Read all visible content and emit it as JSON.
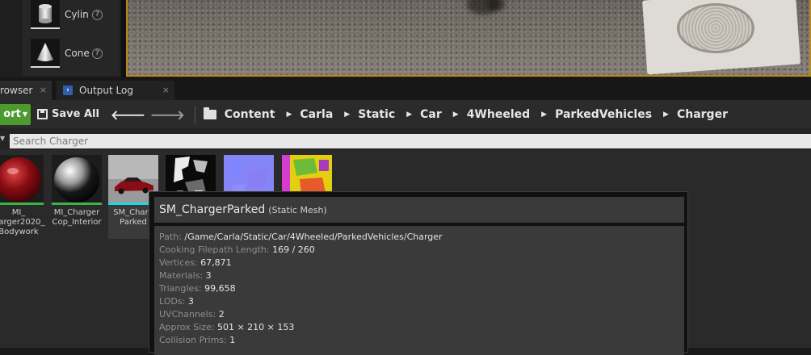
{
  "place_panel": {
    "items": [
      {
        "label": "Cylin",
        "icon": "cylinder-icon"
      },
      {
        "label": "Cone",
        "icon": "cone-icon"
      }
    ]
  },
  "tabs": [
    {
      "label": "rowser",
      "close": "×"
    },
    {
      "label": "Output Log",
      "close": "×"
    }
  ],
  "toolbar": {
    "import_label": "ort",
    "save_all_label": "Save All",
    "breadcrumbs": [
      "Content",
      "Carla",
      "Static",
      "Car",
      "4Wheeled",
      "ParkedVehicles",
      "Charger"
    ]
  },
  "search": {
    "placeholder": "Search Charger"
  },
  "assets": [
    {
      "label": "MI_\nharger2020_\nBodywork",
      "type": "material-instance",
      "thumb": "red-sphere"
    },
    {
      "label": "MI_Charger\nCop_Interior",
      "type": "material-instance",
      "thumb": "black-white-sphere"
    },
    {
      "label": "SM_Charg\nParked",
      "type": "static-mesh",
      "thumb": "red-car"
    },
    {
      "label": "",
      "type": "texture",
      "thumb": "mask-texture"
    },
    {
      "label": "",
      "type": "texture",
      "thumb": "normal-texture"
    },
    {
      "label": "",
      "type": "texture",
      "thumb": "colorful-texture"
    }
  ],
  "tooltip": {
    "name": "SM_ChargerParked",
    "type": "(Static Mesh)",
    "rows": [
      {
        "key": "Path:",
        "value": "/Game/Carla/Static/Car/4Wheeled/ParkedVehicles/Charger"
      },
      {
        "key": "Cooking Filepath Length:",
        "value": "169 / 260"
      },
      {
        "key": "Vertices:",
        "value": "67,871"
      },
      {
        "key": "Materials:",
        "value": "3"
      },
      {
        "key": "Triangles:",
        "value": "99,658"
      },
      {
        "key": "LODs:",
        "value": "3"
      },
      {
        "key": "UVChannels:",
        "value": "2"
      },
      {
        "key": "Approx Size:",
        "value": "501 × 210 × 153"
      },
      {
        "key": "Collision Prims:",
        "value": "1"
      }
    ]
  },
  "colors": {
    "import_green": "#4d9a2f",
    "viewport_border": "#b58a1c",
    "mesh_bar": "#1ad6e6",
    "material_bar": "#3ab54a"
  }
}
